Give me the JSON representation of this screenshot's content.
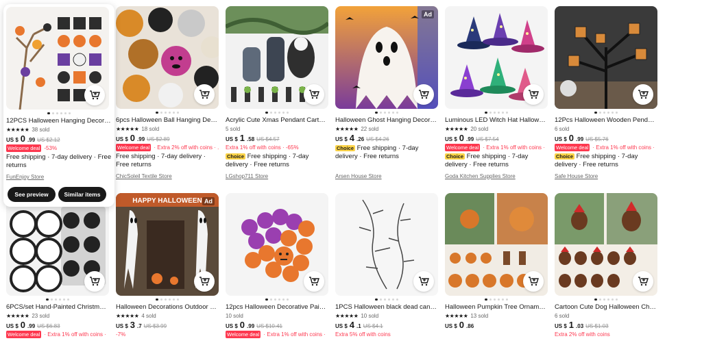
{
  "products": [
    {
      "title": "12PCS Halloween Hanging Decorati...",
      "sold": "38 sold",
      "stars": "★★★★★",
      "currency": "US $",
      "price_int": "0",
      "price_dec": ".99",
      "old_price": "US $2.12",
      "welcome": "Welcome deal",
      "promo": "-53%",
      "choice": "",
      "shipping": "Free shipping · 7-day delivery · Free returns",
      "store": "FunEnjoy Store",
      "see_preview": "See preview",
      "similar_items": "Similar items",
      "ad": ""
    },
    {
      "title": "6pcs Halloween Ball Hanging Decor...",
      "sold": "18 sold",
      "stars": "★★★★★",
      "currency": "US $",
      "price_int": "0",
      "price_dec": ".99",
      "old_price": "US $2.89",
      "welcome": "Welcome deal",
      "promo": "· Extra 2% off with coins · ...",
      "choice": "",
      "shipping": "Free shipping · 7-day delivery · Free returns",
      "store": "ChicSoleil Textile Store",
      "ad": ""
    },
    {
      "title": "Acrylic Cute Xmas Pendant Cartoon ...",
      "sold": "5 sold",
      "stars": "",
      "currency": "US $",
      "price_int": "1",
      "price_dec": ".58",
      "old_price": "US $4.57",
      "welcome": "",
      "promo": "Extra 1% off with coins · -65%",
      "choice": "Choice",
      "shipping": "Free shipping · 7-day delivery · Free returns",
      "store": "LGshop711 Store",
      "ad": ""
    },
    {
      "title": "Halloween Ghost Hanging Decorati...",
      "sold": "22 sold",
      "stars": "★★★★★",
      "currency": "US $",
      "price_int": "4",
      "price_dec": ".26",
      "old_price": "US $4.26",
      "welcome": "",
      "promo": "",
      "choice": "Choice",
      "shipping": "Free shipping · 7-day delivery · Free returns",
      "store": "Arsen House Store",
      "ad": "Ad"
    },
    {
      "title": "Luminous LED Witch Hat Halloween...",
      "sold": "20 sold",
      "stars": "★★★★★",
      "currency": "US $",
      "price_int": "0",
      "price_dec": ".99",
      "old_price": "US $7.54",
      "welcome": "Welcome deal",
      "promo": "· Extra 1% off with coins ·",
      "choice": "Choice",
      "shipping": "Free shipping · 7-day delivery · Free returns",
      "store": "Goda Kitchen Supplies Store",
      "ad": ""
    },
    {
      "title": "12Pcs Halloween Wooden Pendant ...",
      "sold": "6 sold",
      "stars": "",
      "currency": "US $",
      "price_int": "0",
      "price_dec": ".99",
      "old_price": "US $5.76",
      "welcome": "Welcome deal",
      "promo": "· Extra 1% off with coins ·",
      "choice": "Choice",
      "shipping": "Free shipping · 7-day delivery · Free returns",
      "store": "Safe House Store",
      "ad": ""
    },
    {
      "title": "6PCS/set Hand-Painted Christmas T...",
      "sold": "23 sold",
      "stars": "★★★★★",
      "currency": "US $",
      "price_int": "0",
      "price_dec": ".99",
      "old_price": "US $6.83",
      "welcome": "Welcome deal",
      "promo": "· Extra 1% off with coins ·",
      "ad": ""
    },
    {
      "title": "Halloween Decorations Outdoor Gh...",
      "sold": "4 sold",
      "stars": "★★★★★",
      "currency": "US $",
      "price_int": "3",
      "price_dec": ".7",
      "old_price": "US $3.99",
      "welcome": "",
      "promo": "-7%",
      "ad": "Ad"
    },
    {
      "title": "12pcs Halloween Decorative Paint B...",
      "sold": "10 sold",
      "stars": "",
      "currency": "US $",
      "price_int": "0",
      "price_dec": ".99",
      "old_price": "US $10.41",
      "welcome": "Welcome deal",
      "promo": "· Extra 1% off with coins ·",
      "ad": ""
    },
    {
      "title": "1PCS Halloween black dead cane si...",
      "sold": "10 sold",
      "stars": "★★★★★",
      "currency": "US $",
      "price_int": "4",
      "price_dec": ".1",
      "old_price": "US $4.1",
      "welcome": "",
      "promo": "Extra 5% off with coins",
      "ad": ""
    },
    {
      "title": "Halloween Pumpkin Tree Ornament-...",
      "sold": "13 sold",
      "stars": "★★★★★",
      "currency": "US $",
      "price_int": "0",
      "price_dec": ".86",
      "old_price": "",
      "welcome": "",
      "promo": "",
      "ad": ""
    },
    {
      "title": "Cartoon Cute Dog Halloween Christ...",
      "sold": "6 sold",
      "stars": "",
      "currency": "US $",
      "price_int": "1",
      "price_dec": ".03",
      "old_price": "US $1.03",
      "welcome": "",
      "promo": "Extra 2% off with coins",
      "ad": ""
    }
  ]
}
